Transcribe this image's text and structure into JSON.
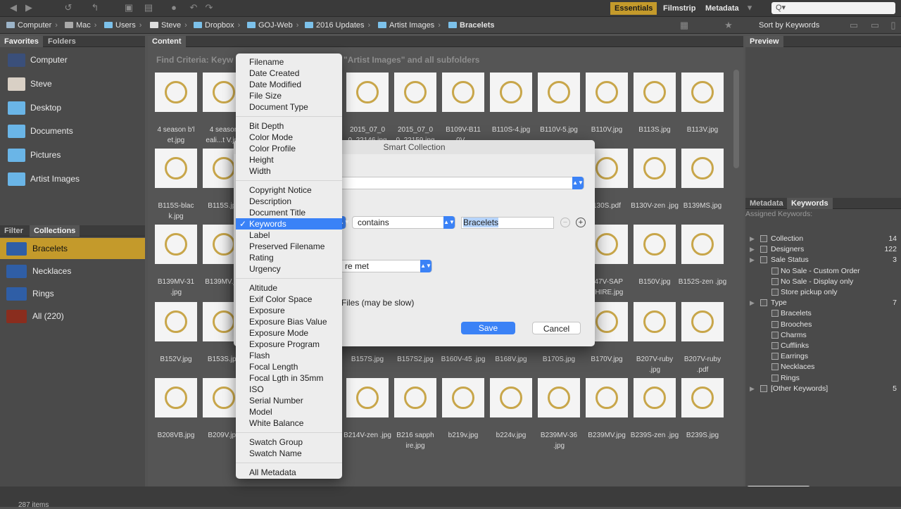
{
  "workspaces": [
    "Essentials",
    "Filmstrip",
    "Metadata"
  ],
  "search_placeholder": "Q▾",
  "breadcrumb": [
    "Computer",
    "Mac",
    "Users",
    "Steve",
    "Dropbox",
    "GOJ-Web",
    "2016 Updates",
    "Artist Images",
    "Bracelets"
  ],
  "sort_label": "Sort by Keywords",
  "left_tabs_top": [
    "Favorites",
    "Folders"
  ],
  "favorites": [
    "Computer",
    "Steve",
    "Desktop",
    "Documents",
    "Pictures",
    "Artist Images"
  ],
  "left_tabs_bottom": [
    "Filter",
    "Collections"
  ],
  "collections": [
    "Bracelets",
    "Necklaces",
    "Rings",
    "All (220)"
  ],
  "content_tab": "Content",
  "find_criteria": "Find Criteria:",
  "find_fragment_left": "Keyw",
  "find_fragment_right": "\"Artist Images\" and all subfolders",
  "thumb_rows": [
    [
      "4 season b'l et.jpg",
      "4 season eali...t V.jpg",
      "",
      "",
      "2015_07_0 0_22146.jpg",
      "2015_07_0 0_22159.jpg",
      "B109V-B11 0V...",
      "B110S-4.jpg",
      "B110V-5.jpg",
      "B110V.jpg",
      "B113S.jpg",
      "B113V.jpg"
    ],
    [
      "B115S-blac k.jpg",
      "B115S.jpg",
      "",
      "",
      "",
      "",
      "",
      "",
      "",
      "130S.pdf",
      "B130V-zen .jpg",
      "B139MS.jpg"
    ],
    [
      "B139MV-31 .jpg",
      "B139MV.jpg",
      "",
      "",
      "",
      "",
      "",
      "",
      "",
      "147V-SAP PHIRE.jpg",
      "B150V.jpg",
      "B152S-zen .jpg"
    ],
    [
      "B152V.jpg",
      "B153S.jpg",
      "",
      "",
      "B157S.jpg",
      "B157S2.jpg",
      "B160V-45 .jpg",
      "B168V.jpg",
      "B170S.jpg",
      "B170V.jpg",
      "B207V-ruby .jpg",
      "B207V-ruby .pdf"
    ],
    [
      "B208VB.jpg",
      "B209V.jpg",
      "",
      "",
      "B214V-zen .jpg",
      "B216 sapph ire.jpg",
      "b219v.jpg",
      "b224v.jpg",
      "B239MV-36 .jpg",
      "B239MV.jpg",
      "B239S-zen .jpg",
      "B239S.jpg"
    ]
  ],
  "right_tabs_top": [
    "Preview"
  ],
  "right_tabs_mid": [
    "Metadata",
    "Keywords"
  ],
  "assigned_keywords": "Assigned Keywords:",
  "keywords": [
    {
      "label": "Collection",
      "count": "14",
      "level": 0
    },
    {
      "label": "Designers",
      "count": "122",
      "level": 0
    },
    {
      "label": "Sale Status",
      "count": "3",
      "level": 0
    },
    {
      "label": "No Sale - Custom Order",
      "count": "",
      "level": 1
    },
    {
      "label": "No Sale - Display only",
      "count": "",
      "level": 1
    },
    {
      "label": "Store pickup only",
      "count": "",
      "level": 1
    },
    {
      "label": "Type",
      "count": "7",
      "level": 0
    },
    {
      "label": "Bracelets",
      "count": "",
      "level": 1
    },
    {
      "label": "Brooches",
      "count": "",
      "level": 1
    },
    {
      "label": "Charms",
      "count": "",
      "level": 1
    },
    {
      "label": "Cufflinks",
      "count": "",
      "level": 1
    },
    {
      "label": "Earrings",
      "count": "",
      "level": 1
    },
    {
      "label": "Necklaces",
      "count": "",
      "level": 1
    },
    {
      "label": "Rings",
      "count": "",
      "level": 1
    },
    {
      "label": "[Other Keywords]",
      "count": "5",
      "level": 0
    }
  ],
  "dialog": {
    "title": "Smart Collection",
    "operator": "contains",
    "value": "Bracelets",
    "match_fragment": "re met",
    "files_fragment": "Files (may be slow)",
    "save": "Save",
    "cancel": "Cancel"
  },
  "menu_groups": [
    [
      "Filename",
      "Date Created",
      "Date Modified",
      "File Size",
      "Document Type"
    ],
    [
      "Bit Depth",
      "Color Mode",
      "Color Profile",
      "Height",
      "Width"
    ],
    [
      "Copyright Notice",
      "Description",
      "Document Title",
      "Keywords",
      "Label",
      "Preserved Filename",
      "Rating",
      "Urgency"
    ],
    [
      "Altitude",
      "Exif Color Space",
      "Exposure",
      "Exposure Bias Value",
      "Exposure Mode",
      "Exposure Program",
      "Flash",
      "Focal Length",
      "Focal Lgth in 35mm",
      "ISO",
      "Serial Number",
      "Model",
      "White Balance"
    ],
    [
      "Swatch Group",
      "Swatch Name"
    ],
    [
      "All Metadata"
    ]
  ],
  "menu_selected": "Keywords",
  "status_items": "287 items"
}
